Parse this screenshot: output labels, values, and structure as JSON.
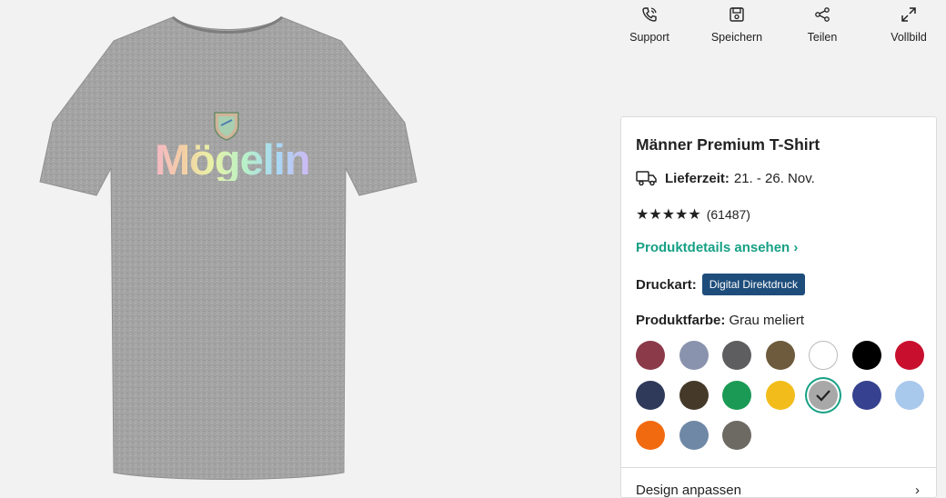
{
  "toolbar": {
    "support": "Support",
    "save": "Speichern",
    "share": "Teilen",
    "fullscreen": "Vollbild"
  },
  "product": {
    "print_text": "Mögelin",
    "title": "Männer Premium T-Shirt",
    "delivery_label": "Lieferzeit:",
    "delivery_value": "21. - 26. Nov.",
    "stars": "★★★★★",
    "review_count": "(61487)",
    "details_link": "Produktdetails ansehen",
    "print_label": "Druckart:",
    "print_badge": "Digital Direktdruck",
    "color_label": "Produktfarbe:",
    "color_value": "Grau meliert",
    "next_row": "Design anpassen"
  },
  "colors": {
    "accent": "#16a085",
    "badge": "#1e4d7b",
    "swatches": [
      "#8b3a4a",
      "#8a93ad",
      "#5e5e60",
      "#6e5a3c",
      "#ffffff",
      "#000000",
      "#c8102e",
      "#2f3a5a",
      "#45392a",
      "#1b9a55",
      "#f2bd1a",
      "#a8a8a8",
      "#36428f",
      "#a8c8ec",
      "#f26a10",
      "#6f88a6",
      "#6d6a64"
    ]
  }
}
